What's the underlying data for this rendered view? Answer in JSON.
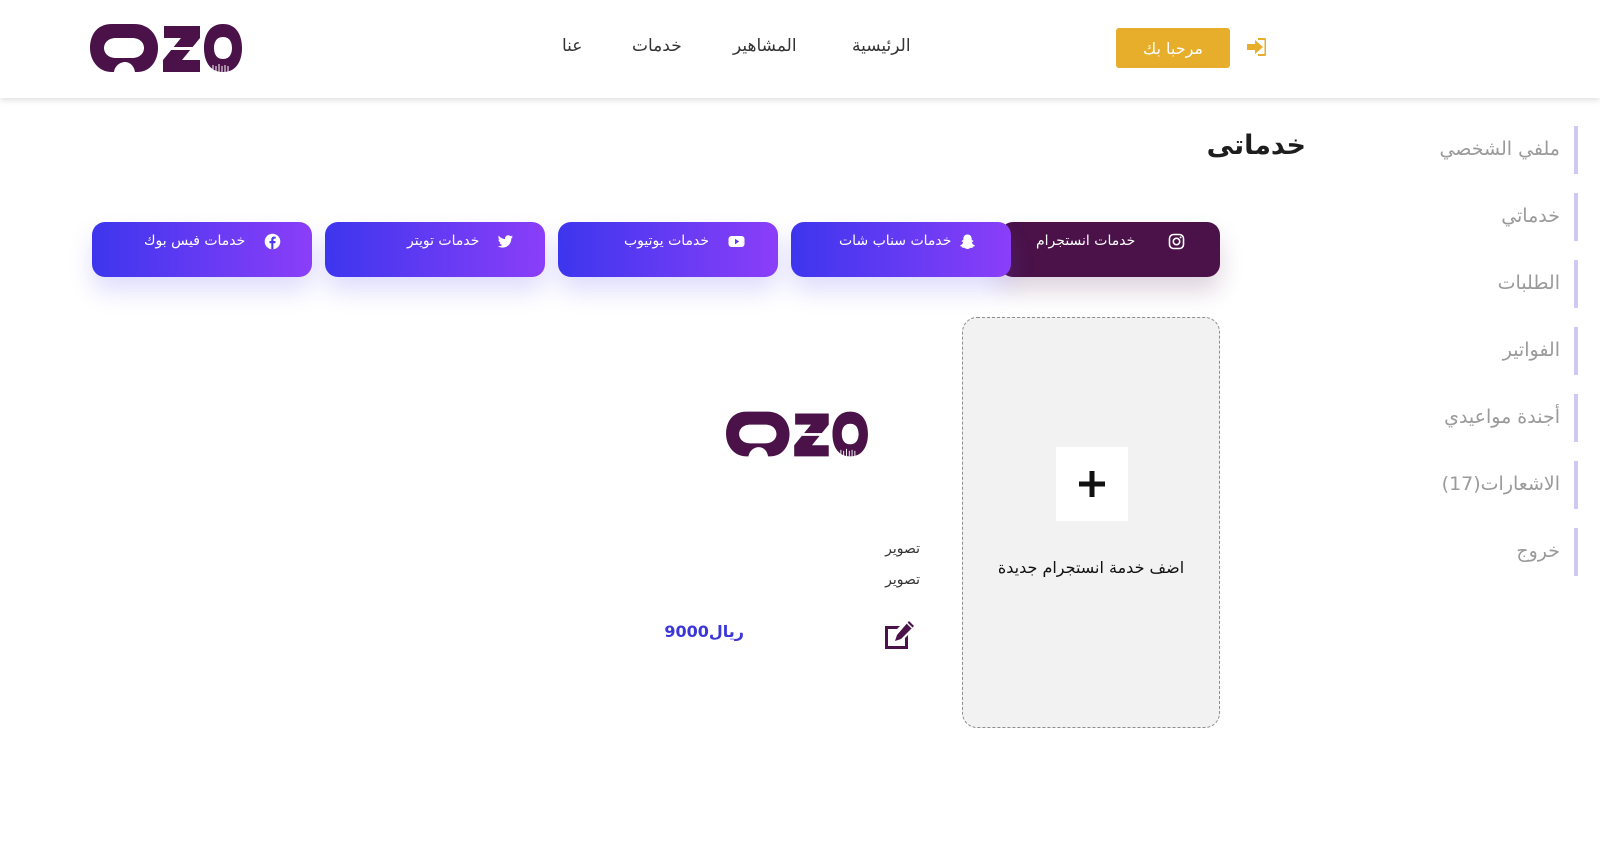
{
  "brand": {
    "logo_text": "OZO",
    "color": "#4a1248"
  },
  "nav": {
    "links": [
      "الرئيسية",
      "المشاهير",
      "خدمات",
      "عنا"
    ],
    "welcome_button": "مرحبا بك",
    "logout_icon": "sign-out-icon",
    "accent": "#e6ae2a"
  },
  "sidebar": {
    "items": [
      {
        "label": "ملفي الشخصي"
      },
      {
        "label": "خدماتي"
      },
      {
        "label": "الطلبات"
      },
      {
        "label": "الفواتير"
      },
      {
        "label": "أجندة مواعيدي"
      },
      {
        "label": "الاشعارات(17)"
      },
      {
        "label": "خروج"
      }
    ]
  },
  "page": {
    "title": "خدماتى"
  },
  "tabs": [
    {
      "label": "خدمات انستجرام",
      "icon": "instagram-icon",
      "active": true
    },
    {
      "label": "خدمات سناب شات",
      "icon": "snapchat-icon",
      "active": false
    },
    {
      "label": "خدمات يوتيوب",
      "icon": "youtube-icon",
      "active": false
    },
    {
      "label": "خدمات تويتر",
      "icon": "twitter-icon",
      "active": false
    },
    {
      "label": "خدمات فيس بوك",
      "icon": "facebook-icon",
      "active": false
    }
  ],
  "add_card": {
    "icon": "plus-icon",
    "label": "اضف خدمة انستجرام جديدة"
  },
  "service": {
    "logo_text": "OZO",
    "line1": "تصوير",
    "line2": "تصوير",
    "price": "9000ريال",
    "edit_icon": "edit-icon"
  },
  "colors": {
    "tab_gradient_start": "#3d36ee",
    "tab_gradient_end": "#8b3ef8",
    "tab_active": "#4a1248",
    "price": "#3b36d9",
    "sidebar_bar": "#cfc7f4"
  }
}
